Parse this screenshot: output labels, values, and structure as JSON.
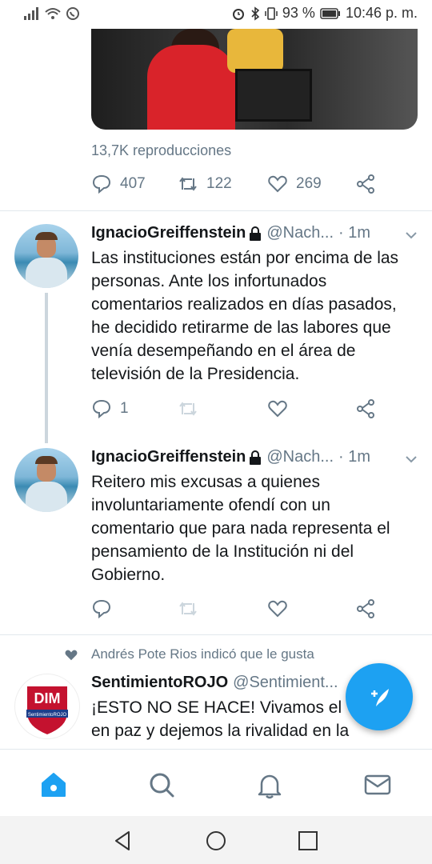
{
  "status_bar": {
    "battery": "93 %",
    "time": "10:46 p. m."
  },
  "previous_tweet": {
    "views": "13,7K reproducciones",
    "replies": "407",
    "retweets": "122",
    "likes": "269"
  },
  "tweets": [
    {
      "name": "IgnacioGreiffenstein",
      "handle": "@Nach...",
      "time": "· 1m",
      "text": "Las instituciones están por encima de las personas. Ante los infortunados comentarios realizados en días pasados, he decidido retirarme de las labores que venía desempeñando en el área de televisión de la Presidencia.",
      "replies": "1"
    },
    {
      "name": "IgnacioGreiffenstein",
      "handle": "@Nach...",
      "time": "· 1m",
      "text": "Reitero mis excusas a quienes involuntariamente ofendí con un comentario que para nada representa el pensamiento de la Institución ni del Gobierno."
    }
  ],
  "liked_tweet": {
    "social_context": "Andrés Pote Rios indicó que le gusta",
    "name": "SentimientoROJO",
    "handle": "@Sentimient...",
    "text_line1": "¡ESTO NO SE HACE! Vivamos el",
    "text_line2": "en paz y dejemos la rivalidad en la",
    "avatar_label": "DIM",
    "avatar_sub": "SentimientoROJO"
  },
  "colors": {
    "accent": "#1da1f2",
    "secondary_text": "#657786",
    "brand_red": "#c4122f"
  },
  "icons": {
    "tabs": [
      "home-icon",
      "search-icon",
      "notifications-icon",
      "messages-icon"
    ],
    "nav": [
      "back-icon",
      "home-nav-icon",
      "recents-icon"
    ]
  }
}
